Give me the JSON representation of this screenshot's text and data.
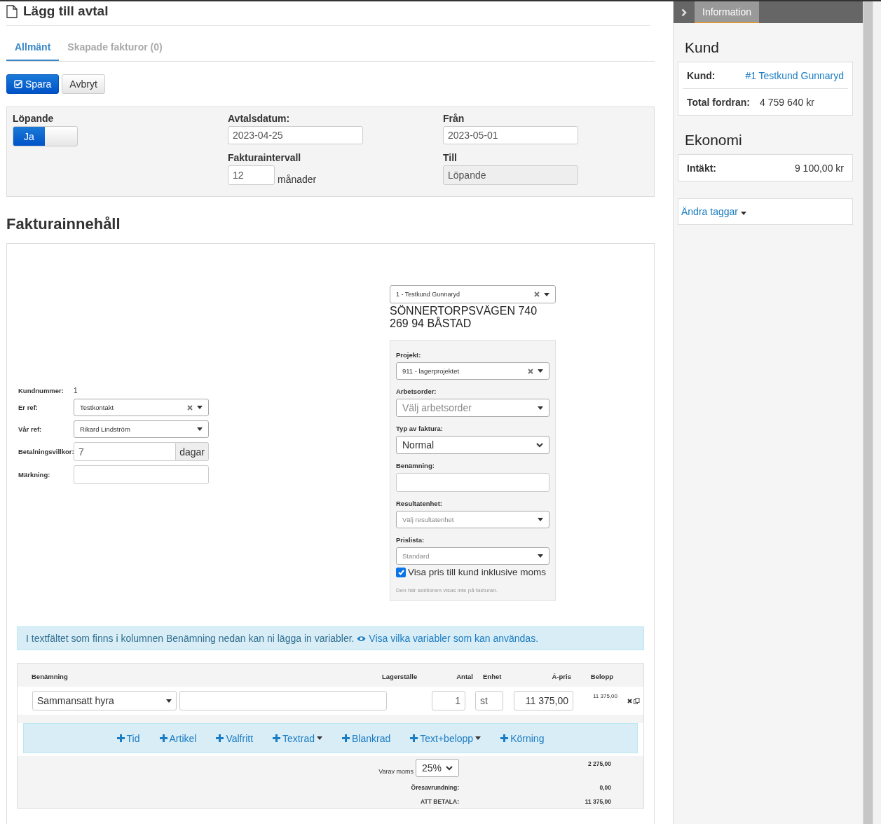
{
  "page": {
    "title": "Lägg till avtal"
  },
  "tabs": [
    {
      "label": "Allmänt",
      "selected": true
    },
    {
      "label": "Skapade fakturor (0)",
      "selected": false
    }
  ],
  "buttons": [
    {
      "label": "Spara",
      "kind": "primary"
    },
    {
      "label": "Avbryt",
      "kind": "default"
    }
  ],
  "contract": {
    "running": {
      "label": "Löpande",
      "toggle_label": "Ja",
      "on": true
    },
    "agreement_date": {
      "label": "Avtalsdatum:",
      "value": "2023-04-25"
    },
    "interval": {
      "label": "Fakturaintervall",
      "value": "12",
      "unit": "månader"
    },
    "from": {
      "label": "Från",
      "value": "2023-05-01"
    },
    "to": {
      "label": "Till",
      "value": "Löpande",
      "disabled": true
    }
  },
  "invoice_content": {
    "heading": "Fakturainnehåll",
    "customer_fields": [
      {
        "label": "Kundnummer:",
        "kind": "text",
        "value": "1"
      },
      {
        "label": "Er ref:",
        "kind": "select",
        "value": "Testkontakt",
        "clearable": true
      },
      {
        "label": "Vår ref:",
        "kind": "select",
        "value": "Rikard Lindström",
        "clearable": false
      },
      {
        "label": "Betalningsvillkor:",
        "kind": "addon",
        "value": "7",
        "addon": "dagar"
      },
      {
        "label": "Märkning:",
        "kind": "input"
      }
    ],
    "customer_select": {
      "value": "1 - Testkund Gunnaryd",
      "clearable": true
    },
    "address_lines": [
      "SÖNNERTORPSVÄGEN 740",
      "269 94 BÅSTAD"
    ],
    "settings_fields": [
      {
        "label": "Projekt:",
        "kind": "select",
        "value": "911 - lagerprojektet",
        "clearable": true
      },
      {
        "label": "Arbetsorder:",
        "kind": "picker",
        "placeholder": "Välj arbetsorder"
      },
      {
        "label": "Typ av faktura:",
        "kind": "native",
        "value": "Normal"
      },
      {
        "label": "Benämning:",
        "kind": "input"
      },
      {
        "label": "Resultatenhet:",
        "kind": "select",
        "placeholder": "Välj resultatenhet",
        "clearable": false
      },
      {
        "label": "Prislista:",
        "kind": "select",
        "placeholder": "Standard",
        "clearable": false
      }
    ],
    "show_incl_vat": {
      "label": "Visa pris till kund inklusive moms",
      "checked": true
    },
    "note": "Den här sektionen visas inte på fakturan."
  },
  "info_alert": {
    "text": "I textfältet som finns i kolumnen Benämning nedan kan ni lägga in variabler.",
    "link": "Visa vilka variabler som kan användas."
  },
  "rows_table": {
    "columns": [
      "Benämning",
      "Lagerställe",
      "Antal",
      "Enhet",
      "Á-pris",
      "Belopp"
    ],
    "rows": [
      {
        "article": "Sammansatt hyra",
        "quantity": "1",
        "unit": "st",
        "unit_price": "11 375,00",
        "amount": "11 375,00"
      }
    ],
    "add_buttons": [
      {
        "label": "Tid",
        "dropdown": false
      },
      {
        "label": "Artikel",
        "dropdown": false
      },
      {
        "label": "Valfritt",
        "dropdown": false
      },
      {
        "label": "Textrad",
        "dropdown": true
      },
      {
        "label": "Blankrad",
        "dropdown": false
      },
      {
        "label": "Text+belopp",
        "dropdown": true
      },
      {
        "label": "Körning",
        "dropdown": false
      }
    ],
    "totals": {
      "vat_label": "Varav moms",
      "vat_rate": "25%",
      "vat_amount": "2 275,00",
      "rounding_label": "Öresavrundning:",
      "rounding": "0,00",
      "total_label": "ATT BETALA:",
      "total": "11 375,00"
    }
  },
  "sidebar": {
    "tab": "Information",
    "sections": [
      {
        "heading": "Kund",
        "rows": [
          {
            "label": "Kund:",
            "kind": "link",
            "value": "#1 Testkund Gunnaryd"
          },
          {
            "label": "Total fordran:",
            "kind": "text",
            "value": "4 759 640 kr"
          }
        ]
      },
      {
        "heading": "Ekonomi",
        "rows": [
          {
            "label": "Intäkt:",
            "kind": "amount",
            "value": "9 100,00 kr"
          }
        ]
      }
    ],
    "tags_link": "Ändra taggar"
  }
}
